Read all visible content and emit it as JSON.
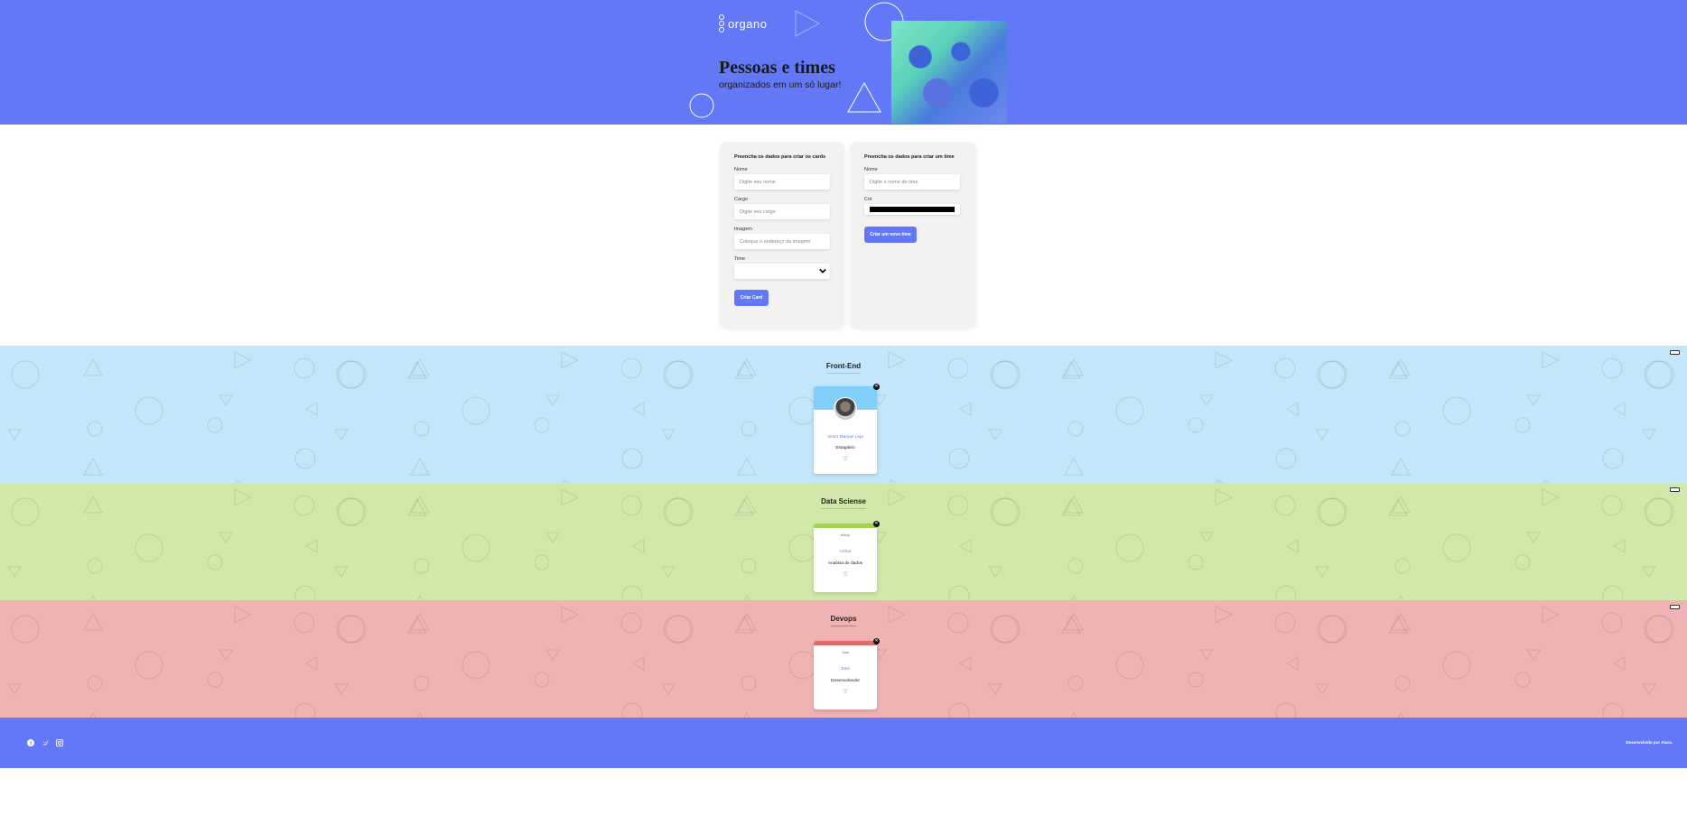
{
  "banner": {
    "logo_text": "organo",
    "title": "Pessoas e times",
    "subtitle": "organizados em um só lugar!"
  },
  "card_form": {
    "title": "Preencha os dados para criar os cards",
    "fields": [
      {
        "label": "Nome",
        "placeholder": "Digite seu nome"
      },
      {
        "label": "Cargo",
        "placeholder": "Digite seu cargo"
      },
      {
        "label": "Imagem",
        "placeholder": "Coloque o endereço da imagem"
      }
    ],
    "select_label": "Time",
    "select_value": "",
    "submit_label": "Criar Card"
  },
  "team_form": {
    "title": "Preencha os dados para criar um time",
    "name_label": "Nome",
    "name_placeholder": "Digite o nome do time",
    "color_label": "Cor",
    "color_value": "#000000",
    "submit_label": "Criar um novo time"
  },
  "teams": [
    {
      "name": "Front-End",
      "bg_color": "#C3E6FA",
      "accent_color": "#82CFFA",
      "members": [
        {
          "name": "Victor Manuel Leja",
          "role": "Estagiário",
          "image_alt": ""
        }
      ]
    },
    {
      "name": "Data Sciense",
      "bg_color": "#D2E8AA",
      "accent_color": "#A6D157",
      "members": [
        {
          "name": "Arthur",
          "role": "Analista de dados",
          "image_alt": "Arthur"
        }
      ]
    },
    {
      "name": "Devops",
      "bg_color": "#EFB3B3",
      "accent_color": "#E06B69",
      "members": [
        {
          "name": "José",
          "role": "Desenvolvedor",
          "image_alt": "José"
        }
      ]
    }
  ],
  "footer": {
    "social_icons": [
      "facebook-icon",
      "twitter-icon",
      "instagram-icon"
    ],
    "credit": "Desenvolvido por Alura."
  },
  "colors": {
    "primary": "#6278F7",
    "banner_bg": "#6278F7",
    "form_bg": "#F2F2F2",
    "card_name": "#6278F7"
  }
}
